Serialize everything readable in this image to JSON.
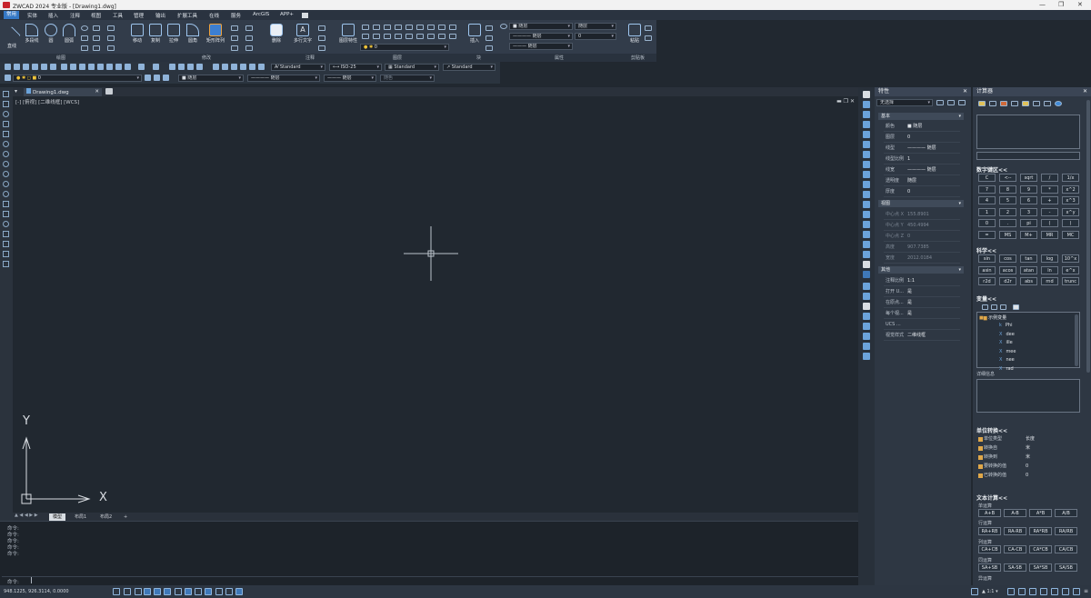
{
  "window": {
    "title": "ZWCAD 2024 专业版 - [Drawing1.dwg]"
  },
  "menu": [
    "常用",
    "实体",
    "插入",
    "注释",
    "视图",
    "工具",
    "管理",
    "输出",
    "扩展工具",
    "在线",
    "服务",
    "ArcGIS",
    "APP+"
  ],
  "ribbon": {
    "draw": {
      "line": "直线",
      "polyline": "多段线",
      "circle": "圆",
      "arc": "圆弧"
    },
    "modify": {
      "move": "移动",
      "copy": "复制",
      "stretch": "拉伸",
      "fillet": "圆角",
      "array": "矩形阵列",
      "erase": "删除"
    },
    "annotate": {
      "mtext": "多行文字"
    },
    "layers": {
      "layer_props": "图层特性",
      "current_layer": "0"
    },
    "block": {
      "insert": "插入"
    },
    "props": {
      "color": "■ 随层",
      "linetype": "———— 随层",
      "lineweight": "——— 随层",
      "layer_pick": "随层",
      "num": "0"
    },
    "clipboard": {
      "paste": "粘贴"
    },
    "panels": [
      "绘图",
      "修改",
      "注释",
      "图层",
      "块",
      "属性",
      "剪贴板"
    ]
  },
  "toolbar": {
    "text_style": "Standard",
    "dim_style": "ISO-25",
    "table_style": "Standard",
    "ml_style": "Standard",
    "layer": "0",
    "color": "■ 随层",
    "linetype": "———— 随层",
    "lineweight": "——— 随层",
    "plot": "随色"
  },
  "doc_tab": "Drawing1.dwg",
  "view_label": "[-] [俯视] [二维线框] [WCS]",
  "axis": {
    "y": "Y",
    "x": "X"
  },
  "layout_tabs": [
    "模型",
    "布局1",
    "布局2",
    "+"
  ],
  "command_lines": [
    "命令:",
    "命令:",
    "命令:",
    "命令:",
    "命令:"
  ],
  "command_prompt": "命令:",
  "status": {
    "coords": "948.1225, 926.3114, 0.0000",
    "scale": "1:1"
  },
  "properties": {
    "title": "特性",
    "selection": "无选择",
    "sections": {
      "basic": "基本",
      "view": "视图",
      "other": "其他"
    },
    "basic": [
      {
        "k": "颜色",
        "v": "■ 随层"
      },
      {
        "k": "图层",
        "v": "0"
      },
      {
        "k": "线型",
        "v": "———— 随层"
      },
      {
        "k": "线型比例",
        "v": "1"
      },
      {
        "k": "线宽",
        "v": "———— 随层"
      },
      {
        "k": "透明度",
        "v": "随层"
      },
      {
        "k": "厚度",
        "v": "0"
      }
    ],
    "view": [
      {
        "k": "中心点 X",
        "v": "155.8901"
      },
      {
        "k": "中心点 Y",
        "v": "450.4994"
      },
      {
        "k": "中心点 Z",
        "v": "0"
      },
      {
        "k": "高度",
        "v": "907.7385"
      },
      {
        "k": "宽度",
        "v": "2012.0184"
      }
    ],
    "other": [
      {
        "k": "注释比例",
        "v": "1:1"
      },
      {
        "k": "打开 U...",
        "v": "是"
      },
      {
        "k": "在原点...",
        "v": "是"
      },
      {
        "k": "每个视...",
        "v": "是"
      },
      {
        "k": "UCS ...",
        "v": ""
      },
      {
        "k": "视觉样式",
        "v": "二维线框"
      }
    ]
  },
  "calculator": {
    "title": "计算器",
    "numpad_label": "数字键区<<",
    "numpad": [
      "C",
      "<--",
      "sqrt",
      "/",
      "1/x",
      "7",
      "8",
      "9",
      "*",
      "x^2",
      "4",
      "5",
      "6",
      "+",
      "x^3",
      "1",
      "2",
      "3",
      "-",
      "x^y",
      "0",
      ".",
      "pi",
      "(",
      ")",
      "=",
      "MS",
      "M+",
      "MR",
      "MC"
    ],
    "sci_label": "科学<<",
    "sci": [
      "sin",
      "cos",
      "tan",
      "log",
      "10^x",
      "asin",
      "acos",
      "atan",
      "ln",
      "e^x",
      "r2d",
      "d2r",
      "abs",
      "rnd",
      "trunc"
    ],
    "vars_label": "变量<<",
    "vars_root": "示例变量",
    "vars": [
      "Phi",
      "dee",
      "ille",
      "mee",
      "nee",
      "rad"
    ],
    "details_label": "详细信息",
    "unit_label": "单位转换<<",
    "units": [
      {
        "k": "单位类型",
        "v": "长度"
      },
      {
        "k": "转换自",
        "v": "米"
      },
      {
        "k": "转换到",
        "v": "米"
      },
      {
        "k": "要转换的值",
        "v": "0"
      },
      {
        "k": "已转换的值",
        "v": "0"
      }
    ],
    "text_calc_label": "文本计算<<",
    "single": {
      "label": "单运算",
      "items": [
        "A+B",
        "A-B",
        "A*B",
        "A/B"
      ]
    },
    "row": {
      "label": "行运算",
      "items": [
        "RA+RB",
        "RA-RB",
        "RA*RB",
        "RA/RB"
      ]
    },
    "col": {
      "label": "列运算",
      "items": [
        "CA+CB",
        "CA-CB",
        "CA*CB",
        "CA/CB"
      ]
    },
    "same": {
      "label": "同运算",
      "items": [
        "SA+SB",
        "SA-SB",
        "SA*SB",
        "SA/SB"
      ]
    },
    "diff": {
      "label": "异运算"
    }
  }
}
